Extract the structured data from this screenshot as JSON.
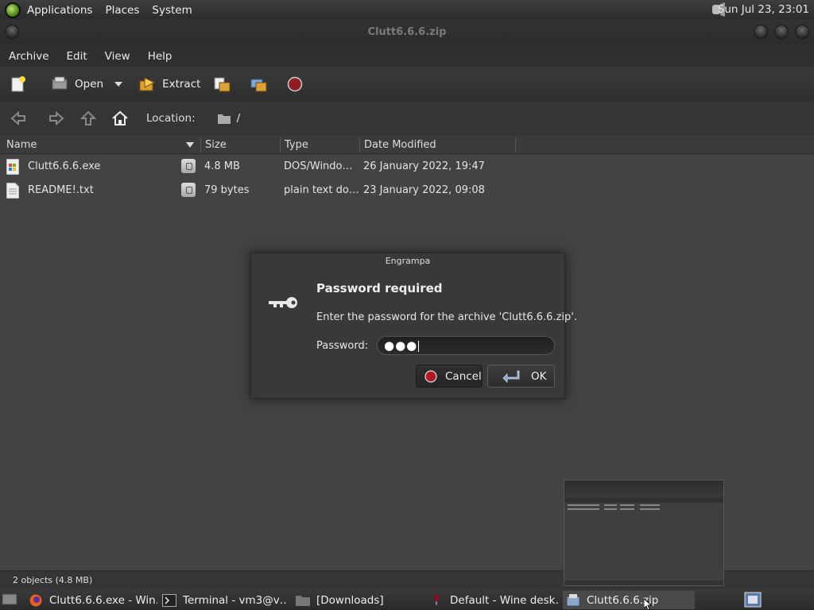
{
  "top_panel": {
    "menus": [
      "Applications",
      "Places",
      "System"
    ],
    "clock": "Sun Jul 23, 23:01"
  },
  "window": {
    "title": "Clutt6.6.6.zip"
  },
  "menubar": [
    "Archive",
    "Edit",
    "View",
    "Help"
  ],
  "toolbar": {
    "open_label": "Open",
    "extract_label": "Extract"
  },
  "location": {
    "label": "Location:",
    "path": "/"
  },
  "file_list": {
    "columns": [
      "Name",
      "Size",
      "Type",
      "Date Modified"
    ],
    "rows": [
      {
        "name": "Clutt6.6.6.exe",
        "size": "4.8 MB",
        "type": "DOS/Windo…",
        "date": "26 January 2022, 19:47"
      },
      {
        "name": "README!.txt",
        "size": "79 bytes",
        "type": "plain text do…",
        "date": "23 January 2022, 09:08"
      }
    ]
  },
  "status": "2 objects (4.8 MB)",
  "dialog": {
    "title": "Engrampa",
    "heading": "Password required",
    "message": "Enter the password for the archive 'Clutt6.6.6.zip'.",
    "password_label": "Password:",
    "password_value": "●●●",
    "cancel_label": "Cancel",
    "ok_label": "OK"
  },
  "taskbar": [
    "Clutt6.6.6.exe - Win…",
    "Terminal - vm3@v…",
    "[Downloads]",
    "Default - Wine desk…",
    "Clutt6.6.6.zip"
  ]
}
